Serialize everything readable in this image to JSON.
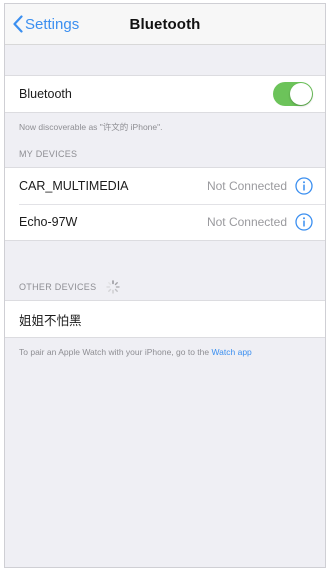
{
  "navbar": {
    "back_label": "Settings",
    "title": "Bluetooth"
  },
  "bluetooth": {
    "label": "Bluetooth",
    "enabled": true,
    "toggle_color": "#6cc35a",
    "discoverable_text": "Now discoverable as \"许文的 iPhone\"."
  },
  "my_devices": {
    "header": "MY DEVICES",
    "items": [
      {
        "name": "CAR_MULTIMEDIA",
        "status": "Not Connected"
      },
      {
        "name": "Echo-97W",
        "status": "Not Connected"
      }
    ]
  },
  "other_devices": {
    "header": "OTHER DEVICES",
    "items": [
      {
        "name": "姐姐不怕黑"
      }
    ]
  },
  "footer": {
    "text": "To pair an Apple Watch with your iPhone, go to the ",
    "link": "Watch app",
    "link_color": "#3b8ff0"
  }
}
